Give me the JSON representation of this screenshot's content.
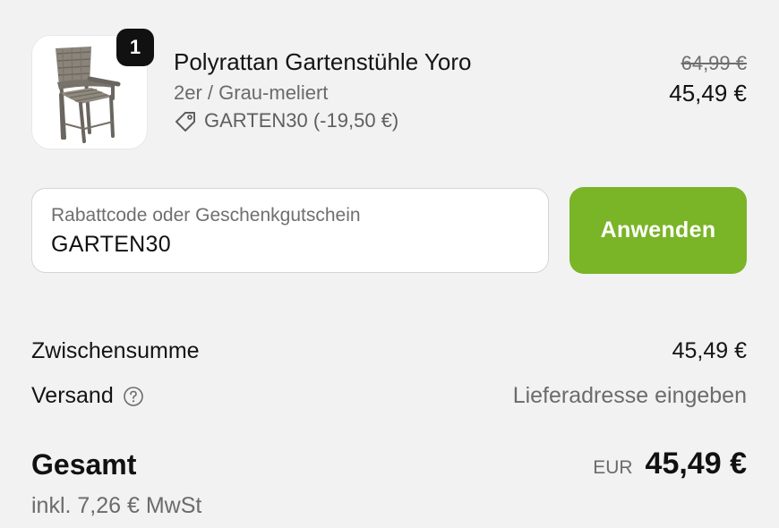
{
  "cart_item": {
    "quantity": "1",
    "name": "Polyrattan Gartenstühle Yoro",
    "variant": "2er / Grau-meliert",
    "discount_code_label": "GARTEN30 (-19,50 €)",
    "original_price": "64,99 €",
    "price": "45,49 €",
    "image_icon": "garden-chair-icon"
  },
  "discount": {
    "label": "Rabattcode oder Geschenkgutschein",
    "value": "GARTEN30",
    "button_label": "Anwenden",
    "button_color": "#7ab427"
  },
  "summary": {
    "subtotal_label": "Zwischensumme",
    "subtotal_value": "45,49 €",
    "shipping_label": "Versand",
    "shipping_value": "Lieferadresse eingeben",
    "total_label": "Gesamt",
    "total_currency": "EUR",
    "total_value": "45,49 €",
    "tax_note": "inkl. 7,26 € MwSt"
  }
}
